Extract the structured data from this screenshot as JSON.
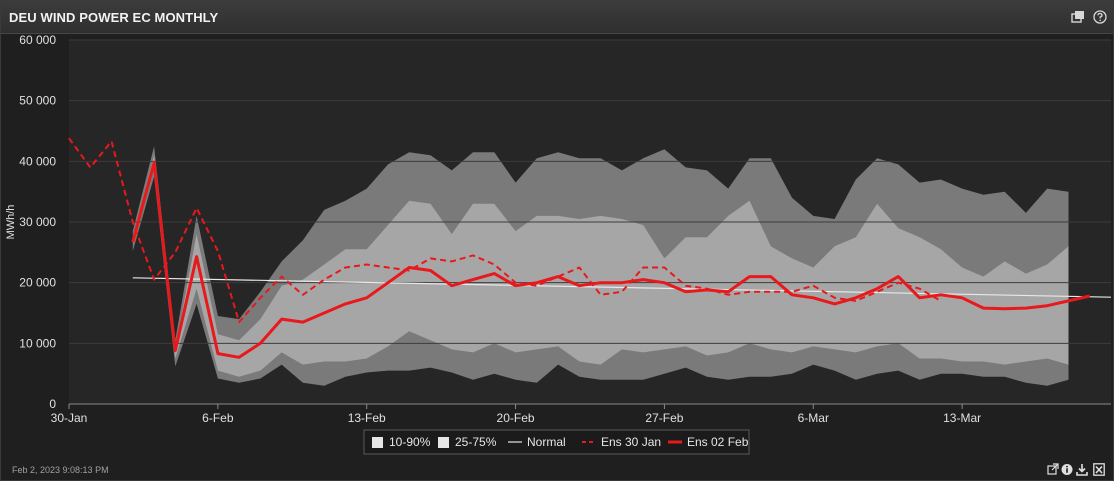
{
  "header": {
    "title": "DEU WIND POWER EC MONTHLY",
    "icons": [
      "maximize-icon",
      "help-icon"
    ]
  },
  "footer": {
    "timestamp": "Feb 2, 2023 9:08:13 PM",
    "icons": [
      "open-external-icon",
      "info-icon",
      "download-icon",
      "export-excel-icon"
    ]
  },
  "colors": {
    "band_10_90": "#7a7a7a",
    "band_25_75": "#a6a6a6",
    "normal": "#e8e8e8",
    "ens": "#e8191c",
    "plot_bg": "#262626"
  },
  "chart_data": {
    "type": "area",
    "title": "",
    "ylabel": "MWh/h",
    "ylim": [
      0,
      60000
    ],
    "yticks": [
      0,
      10000,
      20000,
      30000,
      40000,
      50000,
      60000
    ],
    "ytick_labels": [
      "0",
      "10 000",
      "20 000",
      "30 000",
      "40 000",
      "50 000",
      "60 000"
    ],
    "x_start": "30-Jan",
    "x_end": "20-Mar",
    "xticks": [
      "30-Jan",
      "6-Feb",
      "13-Feb",
      "20-Feb",
      "27-Feb",
      "6-Mar",
      "13-Mar"
    ],
    "x_days": [
      0,
      1,
      2,
      3,
      4,
      5,
      6,
      7,
      8,
      9,
      10,
      11,
      12,
      13,
      14,
      15,
      16,
      17,
      18,
      19,
      20,
      21,
      22,
      23,
      24,
      25,
      26,
      27,
      28,
      29,
      30,
      31,
      32,
      33,
      34,
      35,
      36,
      37,
      38,
      39,
      40,
      41,
      42,
      43,
      44,
      45,
      46,
      47,
      48,
      49
    ],
    "legend": [
      "10-90%",
      "25-75%",
      "Normal",
      "Ens 30 Jan",
      "Ens 02 Feb"
    ],
    "legend_position": "bottom-center",
    "series": [
      {
        "name": "10-90%",
        "kind": "band",
        "start_day": 3,
        "low": [
          25200,
          37500,
          6200,
          16500,
          4200,
          3500,
          4200,
          6500,
          3500,
          3000,
          4500,
          5200,
          5500,
          5500,
          6000,
          5200,
          4000,
          5000,
          4000,
          3500,
          6500,
          4500,
          4000,
          4000,
          4000,
          5000,
          6000,
          4500,
          4000,
          4500,
          4500,
          5000,
          6500,
          5500,
          4000,
          5000,
          5500,
          4000,
          5000,
          5000,
          4500,
          4500,
          3500,
          3000,
          4000
        ],
        "high": [
          28500,
          42500,
          10500,
          31000,
          14500,
          14000,
          18500,
          23500,
          27000,
          32000,
          33500,
          35500,
          39500,
          41500,
          41000,
          38500,
          41500,
          41500,
          36500,
          40500,
          41500,
          40500,
          40500,
          38500,
          40500,
          42000,
          39000,
          38500,
          35500,
          40500,
          40500,
          34000,
          31000,
          30500,
          37000,
          40500,
          39500,
          36500,
          37000,
          35500,
          34500,
          35000,
          31500,
          35500,
          35000
        ]
      },
      {
        "name": "25-75%",
        "kind": "band",
        "start_day": 3,
        "low": [
          26500,
          39000,
          7500,
          19000,
          5500,
          4500,
          5500,
          8500,
          6500,
          7000,
          7000,
          7500,
          9500,
          12000,
          10500,
          9000,
          8500,
          10000,
          8500,
          9000,
          9500,
          7000,
          6500,
          9000,
          8500,
          9000,
          9500,
          8000,
          8500,
          10000,
          9000,
          8500,
          9500,
          9000,
          8500,
          9500,
          10000,
          7500,
          7500,
          7000,
          7000,
          6500,
          7000,
          7500,
          6500
        ],
        "high": [
          27500,
          41000,
          9000,
          28000,
          11500,
          10500,
          14000,
          19500,
          20500,
          23000,
          25500,
          25500,
          29500,
          33500,
          33000,
          28000,
          33000,
          33000,
          28500,
          31000,
          31000,
          30500,
          31000,
          30500,
          29500,
          24000,
          27500,
          27500,
          31000,
          33500,
          26000,
          24000,
          22500,
          26000,
          27500,
          33000,
          29000,
          27500,
          25500,
          22500,
          21000,
          23500,
          21500,
          23000,
          26000
        ]
      },
      {
        "name": "Normal",
        "kind": "line",
        "x": [
          3,
          49
        ],
        "y": [
          20800,
          17600
        ]
      },
      {
        "name": "Ens 30 Jan",
        "kind": "dashed-line",
        "start_day": 0,
        "y": [
          43800,
          39000,
          43300,
          30000,
          20500,
          25000,
          32300,
          25200,
          13500,
          17500,
          21000,
          18000,
          20500,
          22500,
          23000,
          22500,
          22000,
          24000,
          23500,
          24500,
          23000,
          20000,
          19500,
          21000,
          22500,
          18000,
          18500,
          22500,
          22500,
          19500,
          19000,
          18000,
          18500,
          18500,
          18500,
          19500,
          17500,
          17000,
          18500,
          20000,
          19000,
          17000
        ]
      },
      {
        "name": "Ens 02 Feb",
        "kind": "line",
        "start_day": 3,
        "y": [
          26700,
          39800,
          8800,
          24300,
          8300,
          7700,
          10000,
          14000,
          13500,
          15000,
          16500,
          17500,
          20000,
          22500,
          22000,
          19500,
          20500,
          21500,
          19500,
          20000,
          21000,
          19500,
          20000,
          20000,
          20500,
          20000,
          18500,
          18800,
          18500,
          21000,
          21000,
          18000,
          17500,
          16500,
          17500,
          19000,
          21000,
          17500,
          18000,
          17500,
          15800,
          15700,
          15800,
          16200,
          17000,
          17800
        ]
      }
    ]
  }
}
